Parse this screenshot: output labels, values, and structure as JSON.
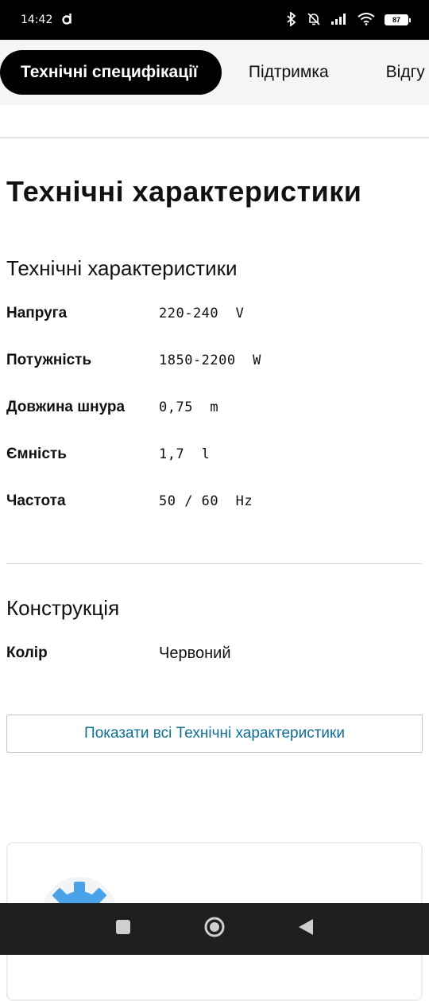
{
  "status_bar": {
    "time": "14:42",
    "battery": "87"
  },
  "tabs": [
    {
      "label": "Технічні специфікації",
      "active": true
    },
    {
      "label": "Підтримка",
      "active": false
    },
    {
      "label": "Відгу",
      "active": false
    }
  ],
  "page_title": "Технічні характеристики",
  "sections": {
    "tech": {
      "title": "Технічні характеристики",
      "rows": [
        {
          "key": "Напруга",
          "value": "220-240  V"
        },
        {
          "key": "Потужність",
          "value": "1850-2200  W"
        },
        {
          "key": "Довжина шнура",
          "value": "0,75  m"
        },
        {
          "key": "Ємність",
          "value": "1,7  l"
        },
        {
          "key": "Частота",
          "value": "50 / 60  Hz"
        }
      ]
    },
    "construction": {
      "title": "Конструкція",
      "rows": [
        {
          "key": "Колір",
          "value": "Червоний"
        }
      ]
    }
  },
  "show_all_button": "Показати всі Технічні характеристики",
  "colors": {
    "accent": "#0e6e96",
    "gear": "#4aa3e8"
  },
  "icons": {
    "nav": [
      "square-icon",
      "home-circle-icon",
      "back-triangle-icon"
    ]
  }
}
